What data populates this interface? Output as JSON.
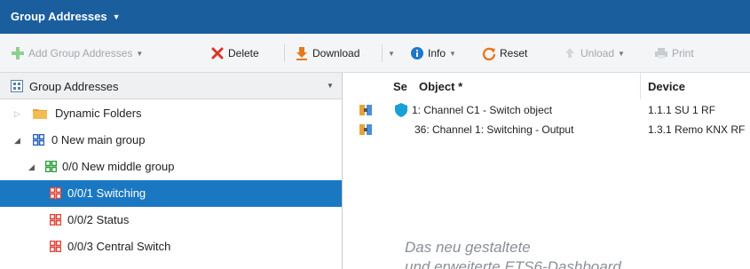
{
  "window": {
    "title": "Group Addresses"
  },
  "toolbar": {
    "add_group_addresses": "Add Group Addresses",
    "delete": "Delete",
    "download": "Download",
    "info": "Info",
    "reset": "Reset",
    "unload": "Unload",
    "print": "Print"
  },
  "left_pane": {
    "header": "Group Addresses",
    "tree": [
      {
        "label": "Dynamic Folders",
        "icon": "folder-icon"
      },
      {
        "label": "0 New main group",
        "icon": "main-group-icon"
      },
      {
        "label": "0/0 New middle group",
        "icon": "middle-group-icon"
      },
      {
        "label": "0/0/1 Switching",
        "icon": "group-address-icon",
        "selected": true
      },
      {
        "label": "0/0/2 Status",
        "icon": "group-address-icon"
      },
      {
        "label": "0/0/3 Central Switch",
        "icon": "group-address-icon"
      }
    ]
  },
  "right_pane": {
    "columns": {
      "se": "Se",
      "object": "Object *",
      "device": "Device"
    },
    "rows": [
      {
        "object": "1: Channel C1 - Switch object",
        "device": "1.1.1 SU 1 RF"
      },
      {
        "object": "36: Channel 1: Switching - Output",
        "device": "1.3.1 Remo KNX RF"
      }
    ]
  },
  "caption": {
    "line1": "Das neu gestaltete",
    "line2": "und erweiterte ETS6-Dashboard"
  },
  "colors": {
    "titlebar": "#1b5e9e",
    "selection": "#1a78c2",
    "delete_red": "#d8362a",
    "download_orange": "#e8781e",
    "info_blue": "#1f77c9",
    "group_red": "#e0453a",
    "group_green": "#2f9e3f",
    "group_blue": "#2a62b8"
  }
}
